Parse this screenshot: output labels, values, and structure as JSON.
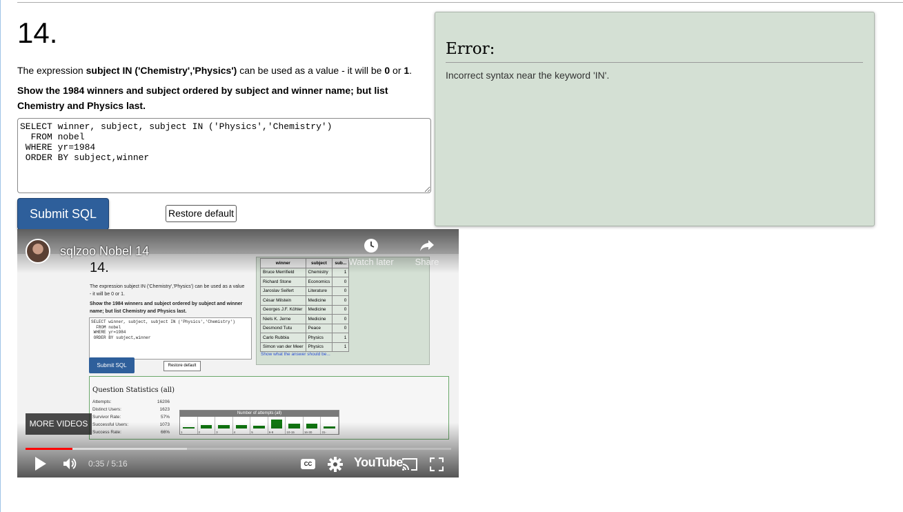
{
  "question": {
    "number": "14.",
    "intro_prefix": "The expression ",
    "intro_bold": "subject IN ('Chemistry','Physics')",
    "intro_middle": " can be used as a value - it will be ",
    "intro_zero": "0",
    "intro_or": " or ",
    "intro_one": "1",
    "intro_end": ".",
    "task": "Show the 1984 winners and subject ordered by subject and winner name; but list Chemistry and Physics last."
  },
  "editor": {
    "sql": "SELECT winner, subject, subject IN ('Physics','Chemistry')\n  FROM nobel\n WHERE yr=1984\n ORDER BY subject,winner"
  },
  "buttons": {
    "submit_label": "Submit SQL",
    "restore_label": "Restore default"
  },
  "error": {
    "title": "Error:",
    "message": "Incorrect syntax near the keyword 'IN'."
  },
  "video": {
    "title": "sqlzoo Nobel 14",
    "watch_later": "Watch later",
    "share": "Share",
    "more_videos": "MORE VIDEOS",
    "time": "0:35 / 5:16",
    "brand": "YouTube",
    "progress_played": 0.111,
    "progress_buffered": 0.38,
    "frame": {
      "heading": "14.",
      "intro": "The expression subject IN ('Chemistry','Physics') can be used as a value - it will be 0 or 1.",
      "task": "Show the 1984 winners and subject ordered by subject and winner name; but list Chemistry and Physics last.",
      "sql": "SELECT winner, subject, subject IN ('Physics','Chemistry')\n  FROM nobel\n WHERE yr=1984\n ORDER BY subject,winner",
      "submit": "Submit SQL",
      "restore": "Restore default",
      "table_headers": [
        "winner",
        "subject",
        "sub..."
      ],
      "table_rows": [
        [
          "Bruce Merrifield",
          "Chemistry",
          "1"
        ],
        [
          "Richard Stone",
          "Economics",
          "0"
        ],
        [
          "Jaroslav Seifert",
          "Literature",
          "0"
        ],
        [
          "César Milstein",
          "Medicine",
          "0"
        ],
        [
          "Georges J.F. Köhler",
          "Medicine",
          "0"
        ],
        [
          "Niels K. Jerne",
          "Medicine",
          "0"
        ],
        [
          "Desmond Tutu",
          "Peace",
          "0"
        ],
        [
          "Carlo Rubbia",
          "Physics",
          "1"
        ],
        [
          "Simon van der Meer",
          "Physics",
          "1"
        ]
      ],
      "show_answer": "Show what the answer should be...",
      "stats_title": "Question Statistics (all)",
      "stats": [
        {
          "label": "Attempts:",
          "value": "16206"
        },
        {
          "label": "Distinct Users:",
          "value": "1623"
        },
        {
          "label": "Survivor Rate:",
          "value": "57%"
        },
        {
          "label": "Successful Users:",
          "value": "1073"
        },
        {
          "label": "Success Rate:",
          "value": "66%"
        }
      ],
      "histogram_title": "Number of attempts (all)",
      "histogram": [
        {
          "label": "1",
          "value": 0.12
        },
        {
          "label": "2",
          "value": 0.35
        },
        {
          "label": "3",
          "value": 0.35
        },
        {
          "label": "4",
          "value": 0.35
        },
        {
          "label": "5",
          "value": 0.25
        },
        {
          "label": "6-9",
          "value": 0.9
        },
        {
          "label": "10-15",
          "value": 0.45
        },
        {
          "label": "16-30",
          "value": 0.45
        },
        {
          "label": "31-",
          "value": 0.2
        }
      ]
    }
  }
}
